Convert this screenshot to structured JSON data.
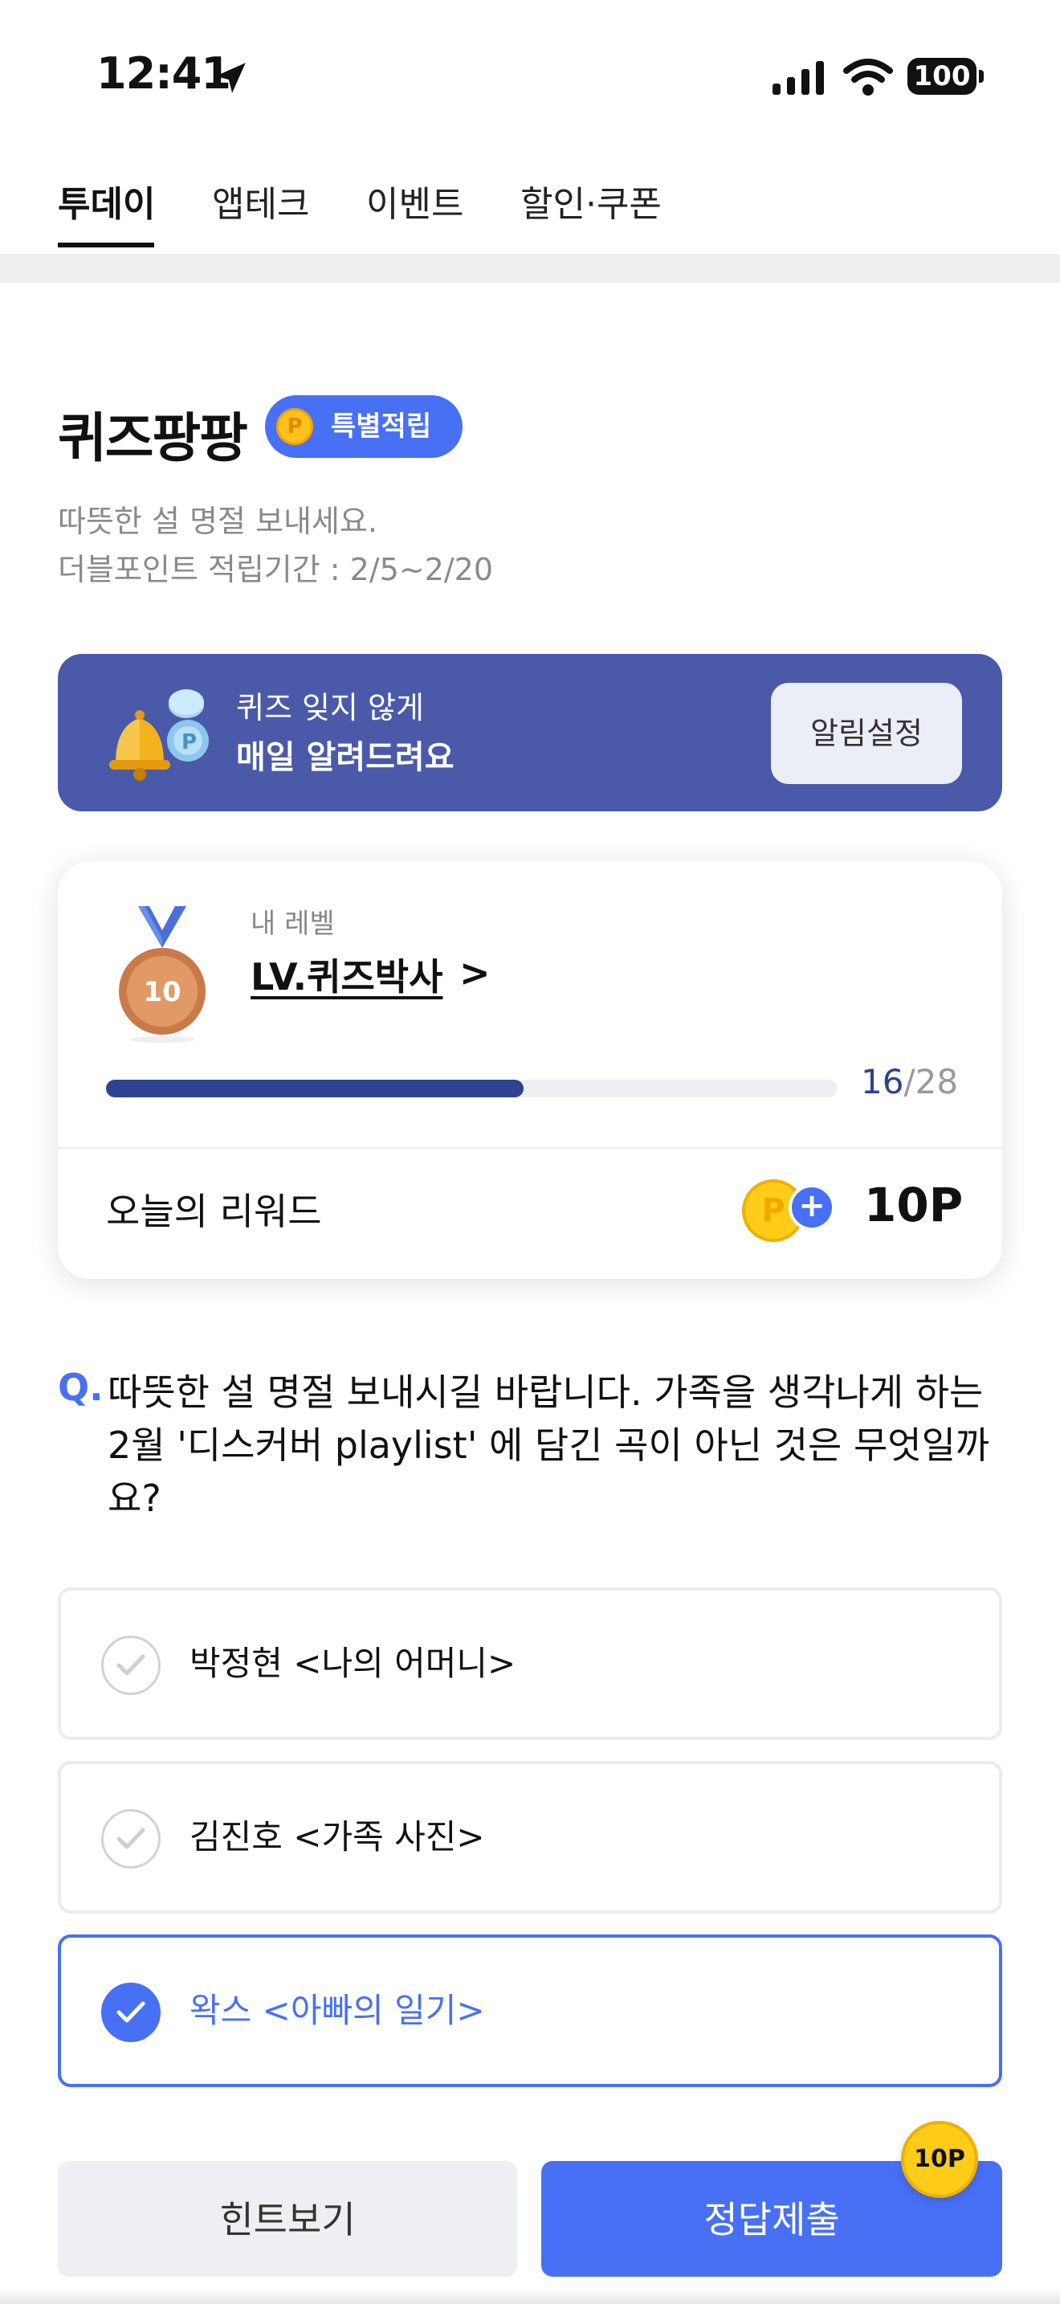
{
  "status_bar": {
    "time": "12:41",
    "battery": "100"
  },
  "tabs": [
    {
      "label": "투데이",
      "active": true
    },
    {
      "label": "앱테크",
      "active": false
    },
    {
      "label": "이벤트",
      "active": false
    },
    {
      "label": "할인·쿠폰",
      "active": false
    }
  ],
  "header": {
    "title": "퀴즈팡팡",
    "badge": "특별적립",
    "badge_coin": "P",
    "subtitle_line1": "따뜻한 설 명절 보내세요.",
    "subtitle_line2": "더블포인트 적립기간 : 2/5~2/20"
  },
  "banner": {
    "line1": "퀴즈 잊지 않게",
    "line2": "매일 알려드려요",
    "button": "알림설정"
  },
  "level_card": {
    "my_level_label": "내 레벨",
    "level_name": "LV.퀴즈박사",
    "chevron": ">",
    "medal_number": "10",
    "progress_current": "16",
    "progress_total": "/28",
    "progress_fraction": 0.571,
    "reward_label": "오늘의 리워드",
    "reward_coin": "P",
    "reward_plus": "+",
    "reward_points": "10P"
  },
  "question": {
    "prefix": "Q.",
    "text": "따뜻한 설 명절 보내시길 바랍니다. 가족을 생각나게 하는 2월 '디스커버 playlist' 에 담긴 곡이 아닌 것은 무엇일까요?"
  },
  "options": [
    {
      "label": "박정현 <나의 어머니>",
      "selected": false
    },
    {
      "label": "김진호 <가족 사진>",
      "selected": false
    },
    {
      "label": "왁스 <아빠의 일기>",
      "selected": true
    }
  ],
  "buttons": {
    "hint": "힌트보기",
    "submit": "정답제출",
    "submit_badge": "10P"
  },
  "colors": {
    "accent": "#4870f5",
    "banner": "#4a5aa8",
    "progress": "#2d4391",
    "coin": "#ffcc1a"
  },
  "icons": [
    "location-arrow-icon",
    "signal-icon",
    "wifi-icon",
    "battery-icon",
    "bell-icon",
    "coin-icon",
    "medal-icon",
    "check-icon",
    "chevron-right-icon",
    "plus-icon"
  ]
}
